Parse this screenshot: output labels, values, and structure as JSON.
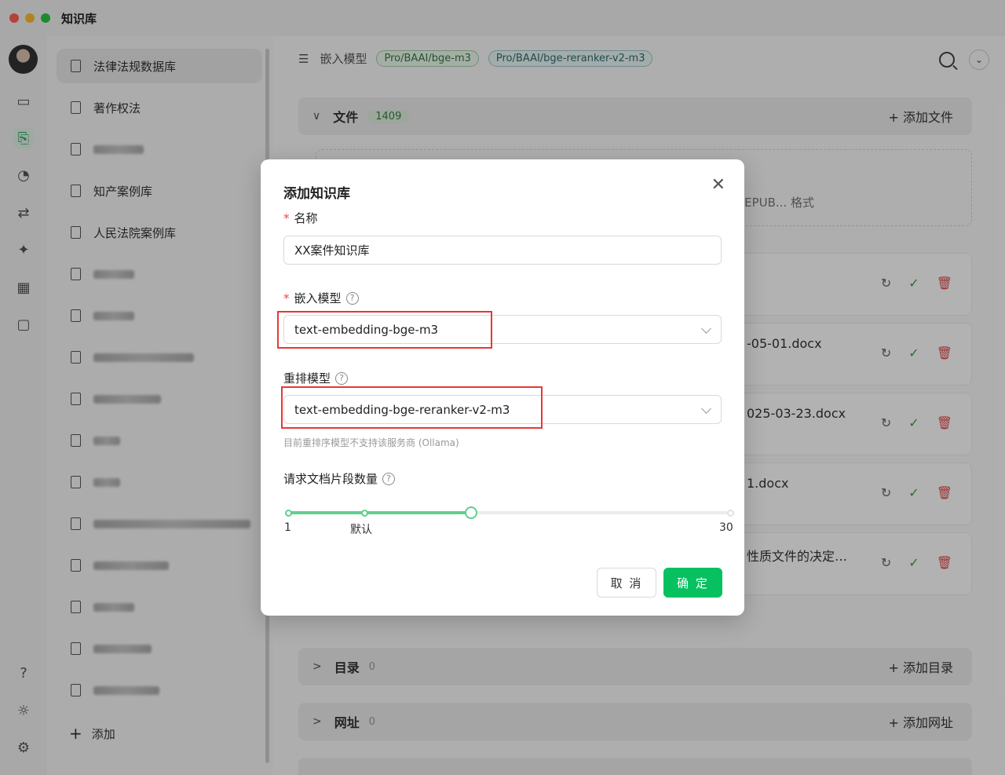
{
  "window": {
    "title": "知识库"
  },
  "kb_list": {
    "items": [
      {
        "label": "法律法规数据库",
        "active": true
      },
      {
        "label": "著作权法"
      },
      {
        "label": ""
      },
      {
        "label": "知产案例库"
      },
      {
        "label": "人民法院案例库"
      }
    ],
    "add_label": "添加"
  },
  "main": {
    "embed_label": "嵌入模型",
    "embed_tag": "Pro/BAAI/bge-m3",
    "rerank_tag": "Pro/BAAI/bge-reranker-v2-m3",
    "files": {
      "title": "文件",
      "count": "1409",
      "add": "添加文件"
    },
    "dropzone_text": "EPUB... 格式",
    "file_rows": [
      "",
      "-05-01.docx",
      "025-03-23.docx",
      "1.docx",
      "性质文件的决定…"
    ],
    "dir": {
      "title": "目录",
      "count": "0",
      "add": "添加目录"
    },
    "url": {
      "title": "网址",
      "count": "0",
      "add": "添加网址"
    }
  },
  "modal": {
    "title": "添加知识库",
    "name_label": "名称",
    "name_value": "XX案件知识库",
    "embed_label": "嵌入模型",
    "embed_value": "text-embedding-bge-m3",
    "rerank_label": "重排模型",
    "rerank_value": "text-embedding-bge-reranker-v2-m3",
    "rerank_hint": "目前重排序模型不支持该服务商 (Ollama)",
    "chunks_label": "请求文档片段数量",
    "slider": {
      "min": "1",
      "default_label": "默认",
      "max": "30",
      "value": 13,
      "default_value": 6
    },
    "cancel": "取 消",
    "ok": "确 定"
  },
  "colors": {
    "accent": "#07c160",
    "highlight": "#e53935"
  }
}
